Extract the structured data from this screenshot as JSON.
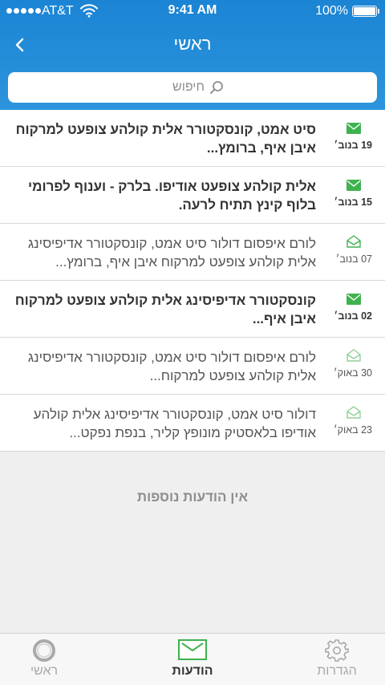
{
  "status_bar": {
    "carrier": "AT&T",
    "time": "9:41 AM",
    "battery": "100%"
  },
  "nav": {
    "title": "ראשי"
  },
  "search": {
    "placeholder": "חיפוש"
  },
  "colors": {
    "header_top": "#1b84d4",
    "header_bottom": "#2d95dc",
    "accent_green": "#3fb24f"
  },
  "messages": [
    {
      "text": "סיט אמט, קונסקטורר אלית קולהע צופעט למרקוח איבן איף, ברומץ...",
      "date": "19 בנוב׳",
      "unread": true
    },
    {
      "text": "אלית קולהע צופעט אודיפו. בלרק - וענוף לפרומי בלוף קינץ תתיח לרעה.",
      "date": "15 בנוב׳",
      "unread": true
    },
    {
      "text": "לורם איפסום דולור סיט אמט, קונסקטורר אדיפיסינג אלית קולהע צופעט למרקוח איבן איף, ברומץ...",
      "date": "07 בנוב׳",
      "unread": false
    },
    {
      "text": "קונסקטורר אדיפיסינג אלית קולהע צופעט למרקוח איבן איף...",
      "date": "02 בנוב׳",
      "unread": true
    },
    {
      "text": "לורם איפסום דולור סיט אמט, קונסקטורר אדיפיסינג אלית קולהע צופעט למרקוח...",
      "date": "30 באוק׳",
      "unread": false
    },
    {
      "text": "דולור סיט אמט, קונסקטורר אדיפיסינג אלית קולהע אודיפו בלאסטיק מונופץ קליר, בנפת נפקט...",
      "date": "23 באוק׳",
      "unread": false
    }
  ],
  "empty_text": "אין הודעות נוספות",
  "tabs": {
    "settings": "הגדרות",
    "messages": "הודעות",
    "home": "ראשי"
  }
}
